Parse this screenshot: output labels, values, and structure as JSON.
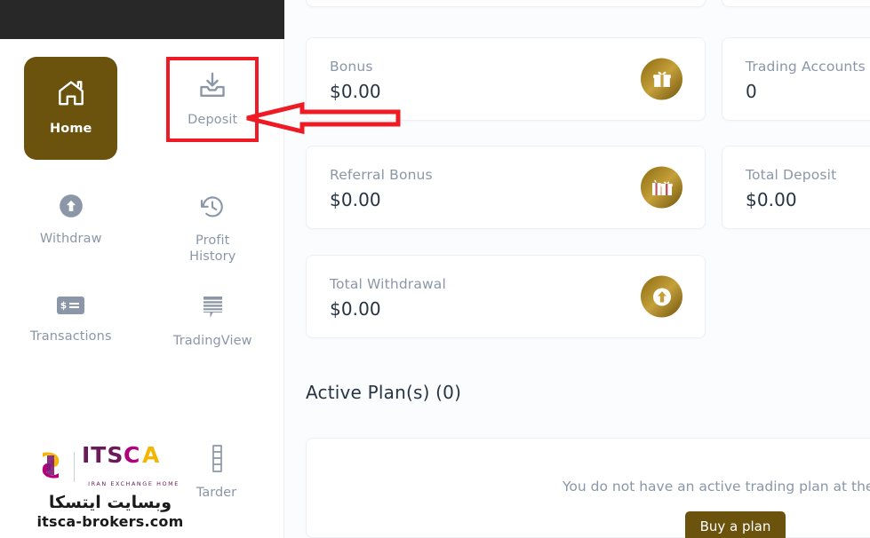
{
  "topbar": {
    "present": true,
    "color": "#282828"
  },
  "sidebar": {
    "tiles": [
      {
        "label": "Home",
        "icon": "home-icon",
        "active": true,
        "highlighted": false
      },
      {
        "label": "Deposit",
        "icon": "deposit-icon",
        "active": false,
        "highlighted": true
      },
      {
        "label": "Withdraw",
        "icon": "withdraw-icon",
        "active": false,
        "highlighted": false
      },
      {
        "label": "Profit\nHistory",
        "icon": "history-icon",
        "active": false,
        "highlighted": false
      },
      {
        "label": "Transactions",
        "icon": "transactions-icon",
        "active": false,
        "highlighted": false
      },
      {
        "label": "TradingView",
        "icon": "tradingview-icon",
        "active": false,
        "highlighted": false
      }
    ],
    "labels": {
      "home": "Home",
      "deposit": "Deposit",
      "withdraw": "Withdraw",
      "profit_history_line1": "Profit",
      "profit_history_line2": "History",
      "transactions": "Transactions",
      "tradingview": "TradingView",
      "tarder": "Tarder"
    },
    "watermark": {
      "brand": "ITSCA",
      "tagline": "IRAN EXCHANGE HOME",
      "persian": "وبسایت ایتسکا",
      "url": "itsca-brokers.com"
    }
  },
  "main": {
    "cards": [
      {
        "label": "Bonus",
        "value": "$0.00",
        "icon": "gift-icon",
        "column": "left"
      },
      {
        "label": "Referral Bonus",
        "value": "$0.00",
        "icon": "gifts-icon",
        "column": "left"
      },
      {
        "label": "Total Withdrawal",
        "value": "$0.00",
        "icon": "arrow-up-circle-icon",
        "column": "left"
      },
      {
        "label": "Trading Accounts",
        "value": "0",
        "icon": null,
        "column": "right"
      },
      {
        "label": "Total Deposit",
        "value": "$0.00",
        "icon": null,
        "column": "right"
      }
    ],
    "section_title": "Active Plan(s) (0)",
    "empty_plan_message": "You do not have an active trading plan at the moment",
    "buy_plan_label": "Buy a plan"
  },
  "annotation": {
    "arrow": {
      "color": "#ee1b24",
      "points_to": "deposit-tile",
      "direction": "left"
    },
    "highlight_box": {
      "color": "#ee1b24",
      "target": "deposit-tile"
    }
  },
  "colors": {
    "accent_brown": "#6b520d",
    "gold_badge": "#c5a03a",
    "muted_text": "#8b97a8",
    "dark_text": "#273444",
    "annotation_red": "#ee1b24",
    "page_bg": "#fbfcfe",
    "topbar": "#282828"
  }
}
